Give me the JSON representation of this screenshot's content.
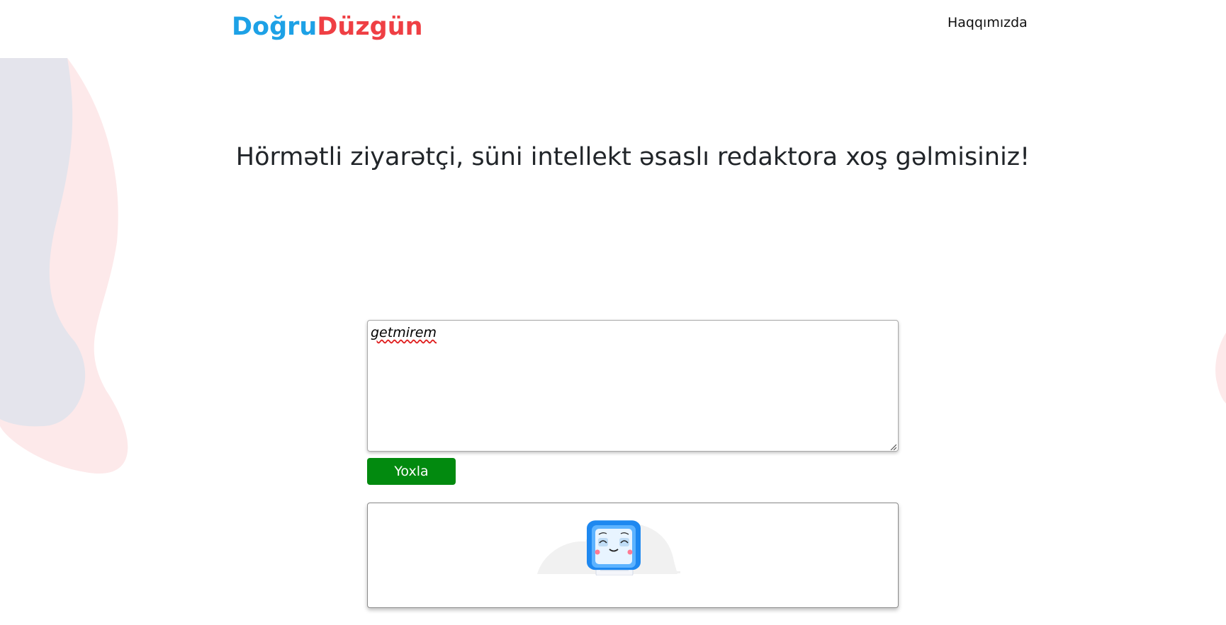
{
  "header": {
    "logo_part1": "Doğru",
    "logo_part2": "Düzgün",
    "nav_about": "Haqqımızda"
  },
  "hero": {
    "title": "Hörmətli ziyarətçi, süni intellekt əsaslı redaktora xoş gəlmisiniz!"
  },
  "editor": {
    "value": "getmirem"
  },
  "actions": {
    "check_label": "Yoxla"
  },
  "result": {
    "illustration": "smiling-computer-mascot"
  },
  "colors": {
    "logo_blue": "#1da1e6",
    "logo_red": "#ef3f44",
    "button_green": "#028a0f",
    "blob_gray": "#e4e4ec",
    "blob_pink": "#fde9ea"
  }
}
